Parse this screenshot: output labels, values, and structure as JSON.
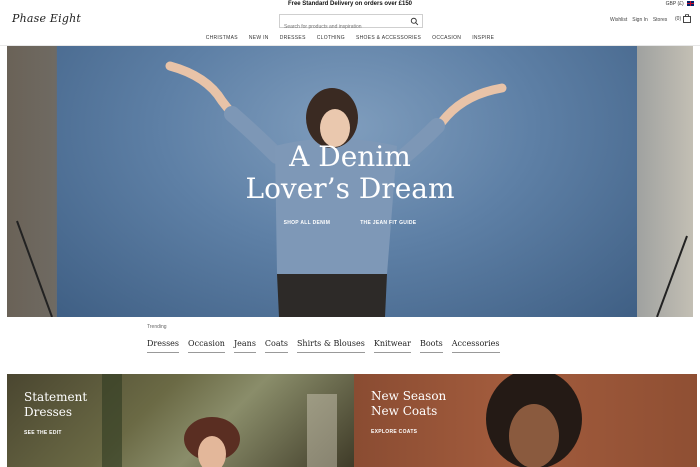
{
  "promo": {
    "text": "Free Standard Delivery on orders over £150",
    "currency": "GBP (£)"
  },
  "header": {
    "logo": "Phase Eight",
    "search_placeholder": "Search for products and inspiration",
    "account_links": [
      "Wishlist",
      "Sign In",
      "Stores"
    ],
    "bag_count": "(0)"
  },
  "nav": [
    "CHRISTMAS",
    "NEW IN",
    "DRESSES",
    "CLOTHING",
    "SHOES & ACCESSORIES",
    "OCCASION",
    "INSPIRE"
  ],
  "hero": {
    "title_line1": "A Denim",
    "title_line2": "Lover’s Dream",
    "links": [
      "SHOP ALL DENIM",
      "THE JEAN FIT GUIDE"
    ]
  },
  "trending": {
    "label": "Trending",
    "items": [
      "Dresses",
      "Occasion",
      "Jeans",
      "Coats",
      "Shirts & Blouses",
      "Knitwear",
      "Boots",
      "Accessories"
    ]
  },
  "tiles": [
    {
      "title_line1": "Statement",
      "title_line2": "Dresses",
      "link": "SEE THE EDIT"
    },
    {
      "title_line1": "New Season",
      "title_line2": "New Coats",
      "link": "EXPLORE COATS"
    }
  ],
  "colors": {
    "hero_blue": "#5b7da3",
    "coats_tile": "#a35c3d",
    "text": "#222222"
  },
  "icons": [
    "search-icon",
    "bag-icon",
    "uk-flag-icon"
  ]
}
